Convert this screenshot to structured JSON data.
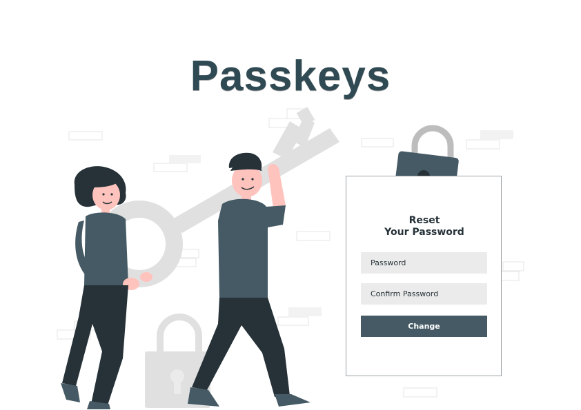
{
  "title": "Passkeys",
  "card": {
    "heading_line1": "Reset",
    "heading_line2": "Your Password",
    "password_placeholder": "Password",
    "confirm_placeholder": "Confirm Password",
    "button_label": "Change"
  },
  "colors": {
    "title": "#304a54",
    "dark_slate": "#455a64",
    "charcoal": "#263238",
    "light_gray": "#ebebeb",
    "skin": "#ffc3bd"
  },
  "icons": [
    "key-icon",
    "padlock-icon",
    "padlock-icon"
  ]
}
